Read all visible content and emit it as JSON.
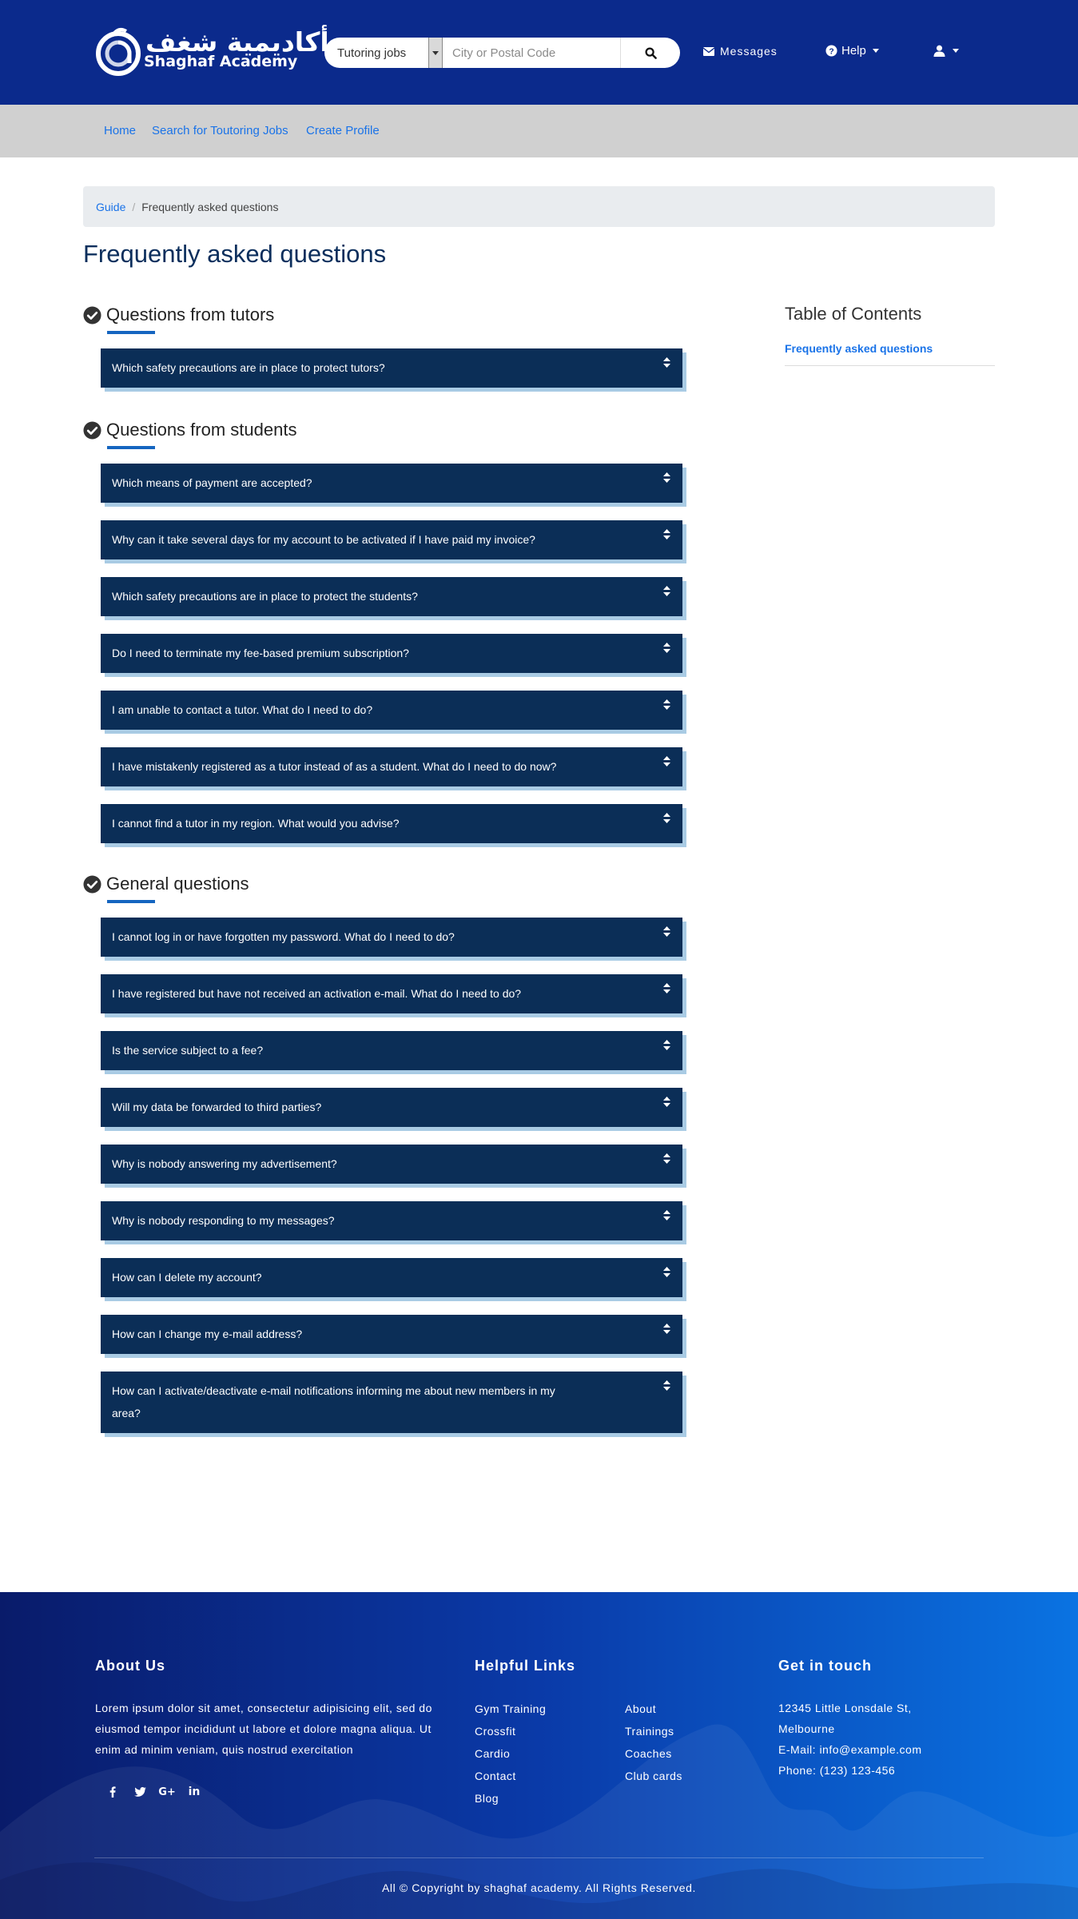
{
  "brand": {
    "name_ar": "أكاديمية شغف",
    "name_en": "Shaghaf Academy"
  },
  "search": {
    "category": "Tutoring jobs",
    "placeholder": "City or Postal Code"
  },
  "header_nav": {
    "messages": "Messages",
    "help": "Help"
  },
  "subnav": [
    "Home",
    "Search for Toutoring Jobs",
    "Create Profile"
  ],
  "breadcrumb": {
    "link": "Guide",
    "separator": "/",
    "current": "Frequently asked questions"
  },
  "page_title": "Frequently asked questions",
  "sections": [
    {
      "title": "Questions from tutors",
      "questions": [
        "Which safety precautions are in place to protect tutors?"
      ]
    },
    {
      "title": "Questions from students",
      "questions": [
        "Which means of payment are accepted?",
        "Why can it take several days for my account to be activated if I have paid my invoice?",
        "Which safety precautions are in place to protect the students?",
        "Do I need to terminate my fee-based premium subscription?",
        "I am unable to contact a tutor. What do I need to do?",
        "I have mistakenly registered as a tutor instead of as a student. What do I need to do now?",
        "I cannot find a tutor in my region. What would you advise?"
      ]
    },
    {
      "title": "General questions",
      "questions": [
        "I cannot log in or have forgotten my password. What do I need to do?",
        "I have registered but have not received an activation e-mail. What do I need to do?",
        "Is the service subject to a fee?",
        "Will my data be forwarded to third parties?",
        "Why is nobody answering my advertisement?",
        "Why is nobody responding to my messages?",
        "How can I delete my account?",
        "How can I change my e-mail address?",
        "How can I activate/deactivate e-mail notifications informing me about new members in my area?"
      ]
    }
  ],
  "toc": {
    "title": "Table of Contents",
    "link": "Frequently asked questions"
  },
  "footer": {
    "about_title": "About Us",
    "about_text": "Lorem ipsum dolor sit amet, consectetur adipisicing elit, sed do eiusmod tempor incididunt ut labore et dolore magna aliqua. Ut enim ad minim veniam, quis nostrud exercitation",
    "social_icons": [
      "facebook-icon",
      "twitter-icon",
      "google-plus-icon",
      "linkedin-icon"
    ],
    "links_title": "Helpful Links",
    "links_col1": [
      "Gym Training",
      "Crossfit",
      "Cardio",
      "Contact",
      "Blog"
    ],
    "links_col2": [
      "About",
      "Trainings",
      "Coaches",
      "Club cards"
    ],
    "contact_title": "Get in touch",
    "address_line1": "12345 Little Lonsdale St,",
    "address_line2": "Melbourne",
    "email": "E-Mail: info@example.com",
    "phone": "Phone: (123) 123-456",
    "copyright": "All © Copyright by shaghaf academy. All Rights Reserved."
  },
  "colors": {
    "header_bg": "#0b2a8c",
    "subnav_bg": "#d0d0d0",
    "link": "#1a73e8",
    "faq_bg": "#0b2e57",
    "faq_shadow": "#a9cbe4",
    "title": "#0b2e5c",
    "underline": "#1565c0"
  }
}
